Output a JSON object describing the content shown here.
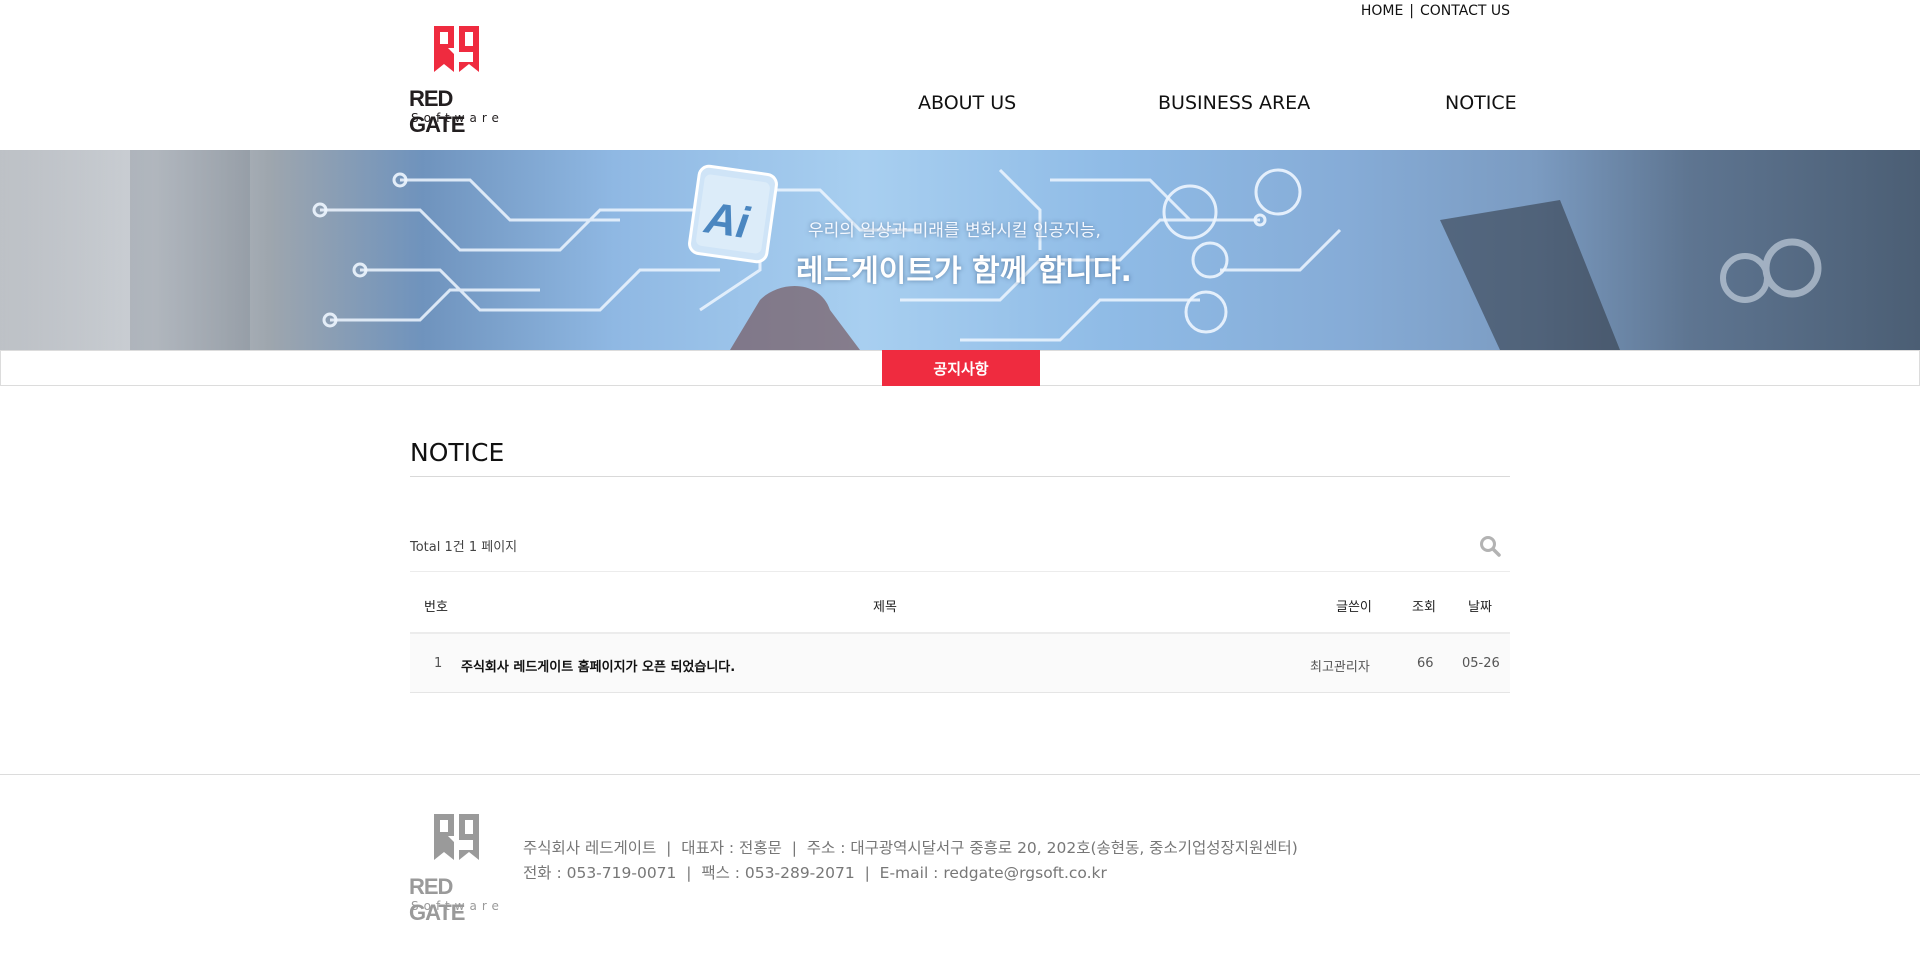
{
  "header": {
    "util_links": [
      "HOME",
      "CONTACT US"
    ],
    "util_separator": "|",
    "logo": {
      "wordmark": "RED GATE",
      "sub": "Software"
    },
    "nav": [
      "ABOUT US",
      "BUSINESS AREA",
      "NOTICE"
    ]
  },
  "banner": {
    "line1": "우리의 일상과 미래를 변화시킬 인공지능,",
    "line2": "레드게이트가 함께 합니다.",
    "badge": "Ai"
  },
  "subnav": {
    "active": "공지사항"
  },
  "board": {
    "title": "NOTICE",
    "total": "Total 1건 1 페이지",
    "columns": {
      "num": "번호",
      "subject": "제목",
      "writer": "글쓴이",
      "hit": "조회",
      "date": "날짜"
    },
    "rows": [
      {
        "num": "1",
        "subject": "주식회사 레드게이트 홈페이지가 오픈 되었습니다.",
        "writer": "최고관리자",
        "hit": "66",
        "date": "05-26"
      }
    ]
  },
  "footer": {
    "logo": {
      "wordmark": "RED GATE",
      "sub": "Software"
    },
    "line1": "주식회사 레드게이트  |  대표자 : 전홍문  |  주소 : 대구광역시달서구 중흥로 20, 202호(송현동, 중소기업성장지원센터)",
    "line2": "전화 : 053-719-0071  |  팩스 : 053-289-2071  |  E-mail : redgate@rgsoft.co.kr"
  },
  "colors": {
    "accent": "#ef2b3f",
    "logo_footer": "#9a9a9a"
  }
}
